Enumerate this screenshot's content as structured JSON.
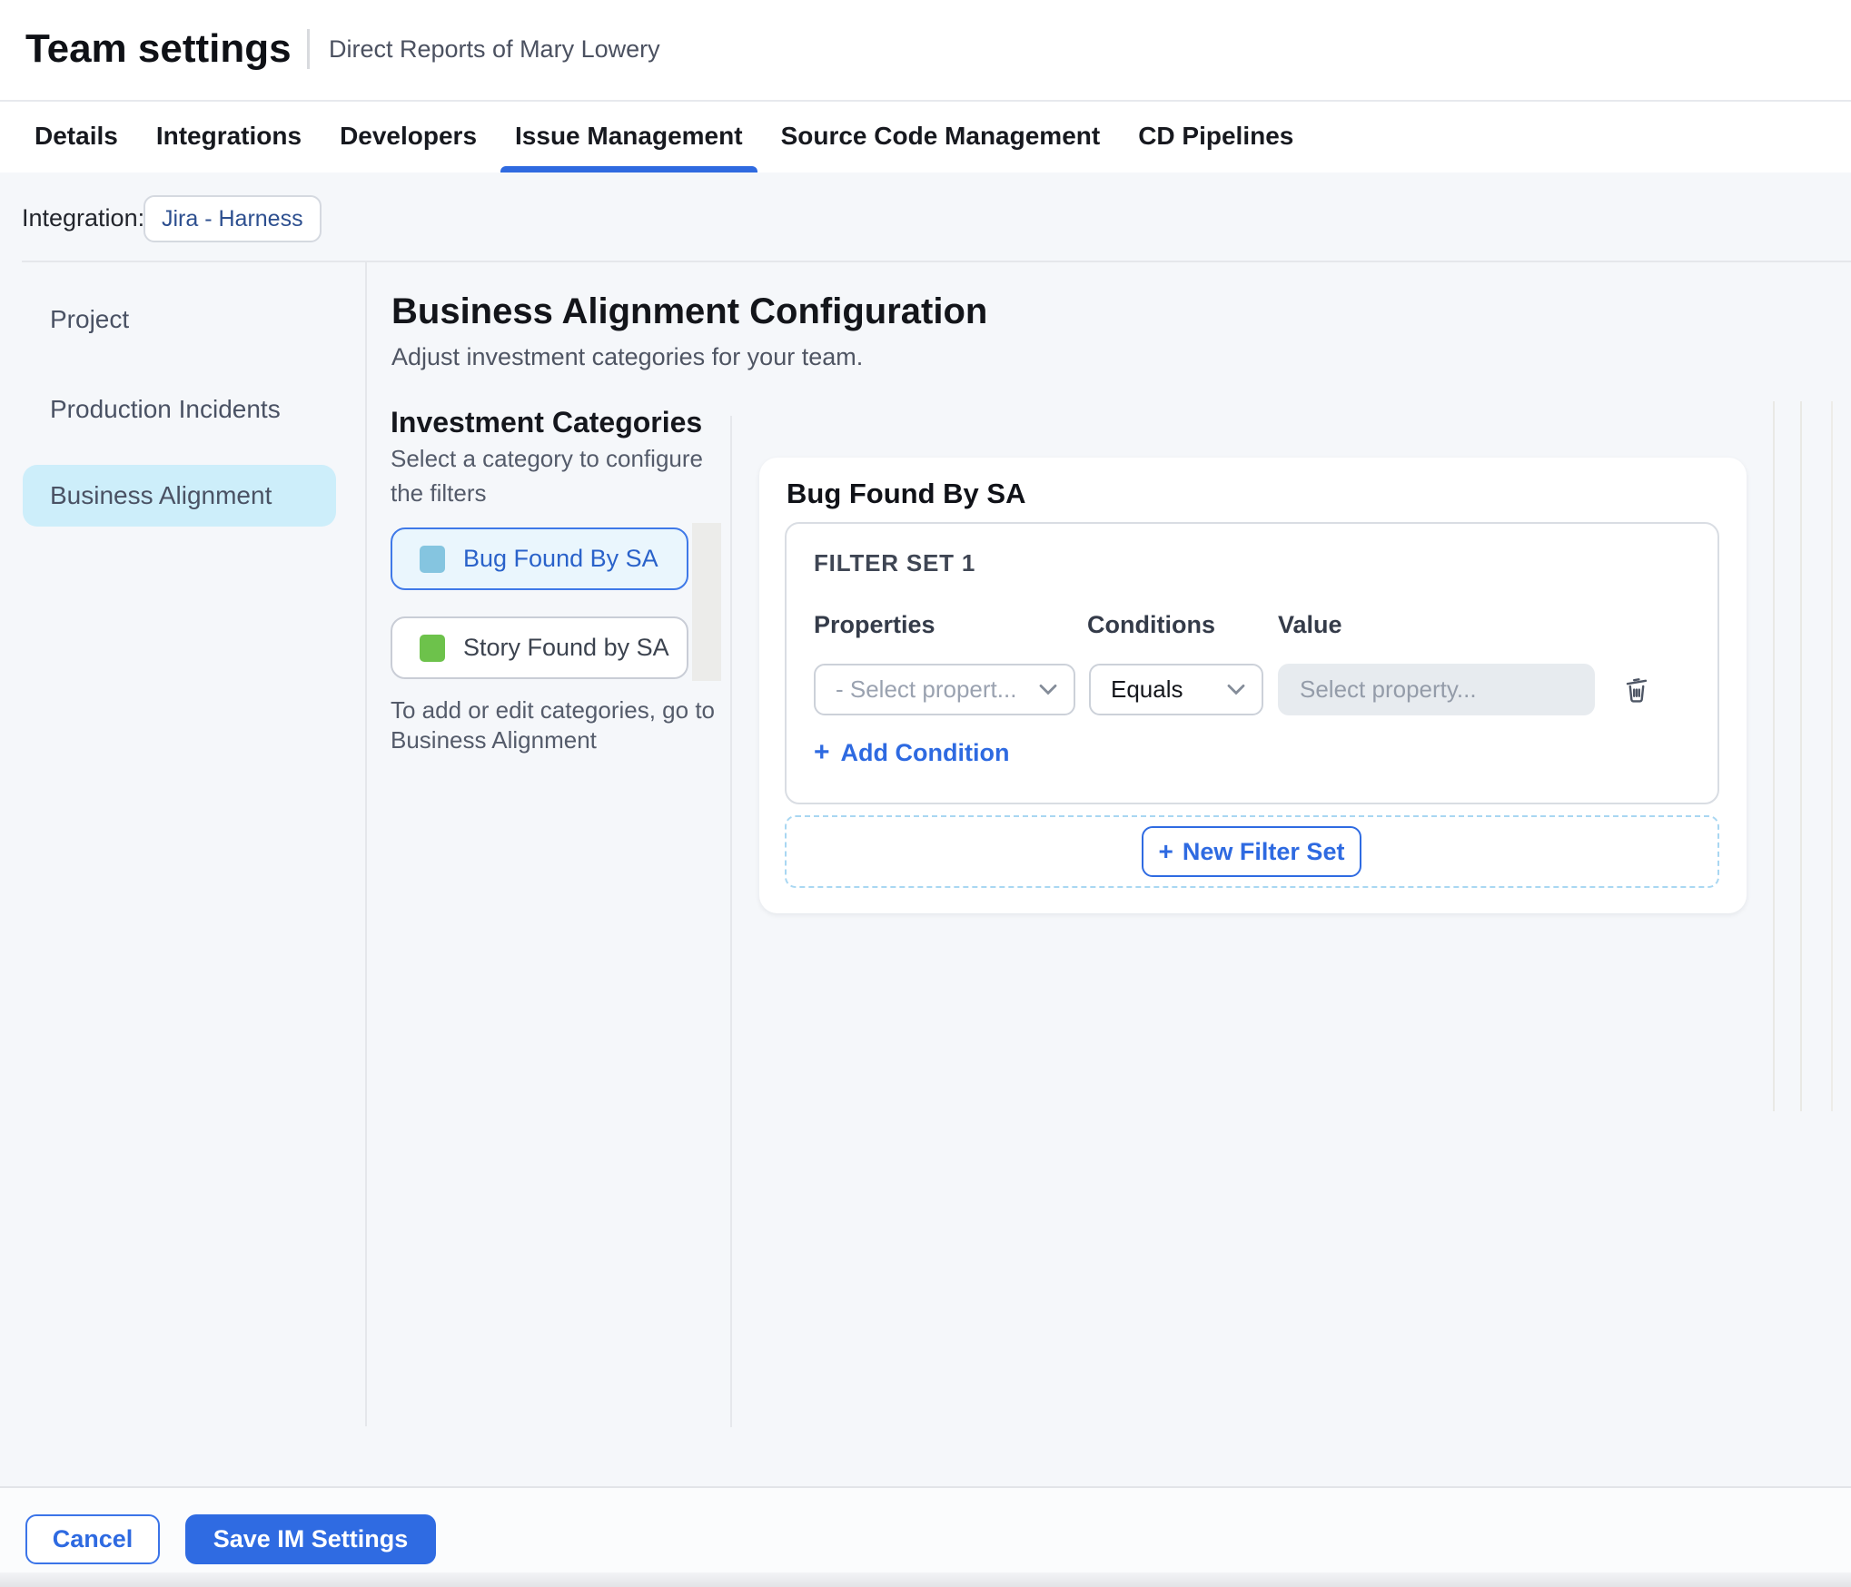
{
  "header": {
    "title": "Team settings",
    "subtitle": "Direct Reports of Mary Lowery"
  },
  "tabs": {
    "items": [
      {
        "label": "Details"
      },
      {
        "label": "Integrations"
      },
      {
        "label": "Developers"
      },
      {
        "label": "Issue Management"
      },
      {
        "label": "Source Code Management"
      },
      {
        "label": "CD Pipelines"
      }
    ],
    "active": "Issue Management",
    "active_color": "#2f6ae0"
  },
  "integration": {
    "label": "Integration:",
    "value": "Jira - Harness"
  },
  "sidebar": {
    "items": [
      {
        "label": "Project"
      },
      {
        "label": "Production Incidents"
      },
      {
        "label": "Business Alignment"
      }
    ],
    "selected": "Business Alignment",
    "selected_bg": "#cdeefa"
  },
  "main": {
    "heading": "Business Alignment Configuration",
    "subheading": "Adjust investment categories for your team."
  },
  "categories": {
    "heading": "Investment Categories",
    "description": "Select a category to configure the filters",
    "items": [
      {
        "label": "Bug Found By SA",
        "color": "#85c5e0",
        "selected": true
      },
      {
        "label": "Story Found by SA",
        "color": "#6dc24b",
        "selected": false
      }
    ],
    "note_line1": "To add or edit categories, go to",
    "note_line2": "Business Alignment"
  },
  "panel": {
    "heading": "Bug Found By SA",
    "filter_set": {
      "title": "FILTER SET 1",
      "columns": [
        "Properties",
        "Conditions",
        "Value"
      ],
      "property_placeholder": "- Select propert...",
      "condition_value": "Equals",
      "value_placeholder": "Select property...",
      "add_condition_label": "Add Condition"
    },
    "new_filter_set_label": "New Filter Set"
  },
  "footer": {
    "cancel_label": "Cancel",
    "save_label": "Save IM Settings"
  },
  "colors": {
    "accent_blue": "#2f6be2",
    "page_bg": "#f5f7fa",
    "selected_item_bg": "#cdeefa",
    "bug_swatch": "#85c5e0",
    "story_swatch": "#6dc24b"
  }
}
